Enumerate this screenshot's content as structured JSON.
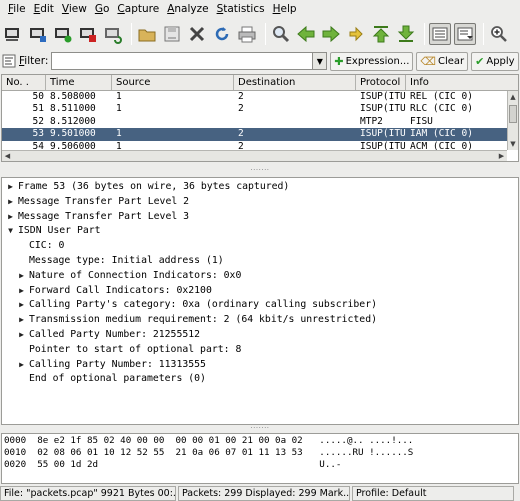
{
  "menu": [
    "File",
    "Edit",
    "View",
    "Go",
    "Capture",
    "Analyze",
    "Statistics",
    "Help"
  ],
  "menu_mnemonics": [
    "F",
    "E",
    "V",
    "G",
    "C",
    "A",
    "S",
    "H"
  ],
  "toolbar_icons": [
    "interface-list-icon",
    "capture-options-icon",
    "start-capture-icon",
    "stop-capture-icon",
    "restart-capture-icon",
    "open-file-icon",
    "save-file-icon",
    "close-file-icon",
    "reload-icon",
    "print-icon",
    "find-packet-icon",
    "go-back-icon",
    "go-forward-icon",
    "go-to-packet-icon",
    "go-first-packet-icon",
    "go-last-packet-icon",
    "colorize-icon",
    "autoscroll-icon",
    "zoom-in-icon"
  ],
  "filter": {
    "label": "Filter:",
    "value": "",
    "expression_label": "Expression...",
    "clear_label": "Clear",
    "apply_label": "Apply"
  },
  "packet_list": {
    "columns": [
      "No. .",
      "Time",
      "Source",
      "Destination",
      "Protocol",
      "Info"
    ],
    "rows": [
      {
        "no": "50",
        "time": "8.508000",
        "src": "1",
        "dst": "2",
        "proto": "ISUP(ITU",
        "info": "REL (CIC 0)",
        "selected": false
      },
      {
        "no": "51",
        "time": "8.511000",
        "src": "1",
        "dst": "2",
        "proto": "ISUP(ITU",
        "info": "RLC (CIC 0)",
        "selected": false
      },
      {
        "no": "52",
        "time": "8.512000",
        "src": "",
        "dst": "",
        "proto": "MTP2",
        "info": "FISU",
        "selected": false
      },
      {
        "no": "53",
        "time": "9.501000",
        "src": "1",
        "dst": "2",
        "proto": "ISUP(ITU",
        "info": "IAM (CIC 0)",
        "selected": true
      },
      {
        "no": "54",
        "time": "9.506000",
        "src": "1",
        "dst": "2",
        "proto": "ISUP(ITU",
        "info": "ACM (CIC 0)",
        "selected": false
      }
    ]
  },
  "details": [
    {
      "text": "Frame 53 (36 bytes on wire, 36 bytes captured)",
      "level": 1,
      "expander": "collapsed"
    },
    {
      "text": "Message Transfer Part Level 2",
      "level": 1,
      "expander": "collapsed"
    },
    {
      "text": "Message Transfer Part Level 3",
      "level": 1,
      "expander": "collapsed"
    },
    {
      "text": "ISDN User Part",
      "level": 1,
      "expander": "expanded"
    },
    {
      "text": "CIC: 0",
      "level": 2,
      "expander": "none"
    },
    {
      "text": "Message type: Initial address (1)",
      "level": 2,
      "expander": "none"
    },
    {
      "text": "Nature of Connection Indicators: 0x0",
      "level": 2,
      "expander": "collapsed"
    },
    {
      "text": "Forward Call Indicators: 0x2100",
      "level": 2,
      "expander": "collapsed"
    },
    {
      "text": "Calling Party's category: 0xa (ordinary calling subscriber)",
      "level": 2,
      "expander": "collapsed"
    },
    {
      "text": "Transmission medium requirement: 2 (64 kbit/s unrestricted)",
      "level": 2,
      "expander": "collapsed"
    },
    {
      "text": "Called Party Number: 21255512",
      "level": 2,
      "expander": "collapsed"
    },
    {
      "text": "Pointer to start of optional part: 8",
      "level": 2,
      "expander": "none"
    },
    {
      "text": "Calling Party Number: 11313555",
      "level": 2,
      "expander": "collapsed"
    },
    {
      "text": "End of optional parameters (0)",
      "level": 2,
      "expander": "none"
    }
  ],
  "bytes": [
    "0000  8e e2 1f 85 02 40 00 00  00 00 01 00 21 00 0a 02   .....@.. ....!...",
    "0010  02 08 06 01 10 12 52 55  21 0a 06 07 01 11 13 53   ......RU !......S",
    "0020  55 00 1d 2d                                        U..-"
  ],
  "status": {
    "file": "File: \"packets.pcap\" 9921 Bytes 00:...",
    "packets": "Packets: 299 Displayed: 299 Mark...",
    "profile": "Profile: Default"
  },
  "colors": {
    "selection": "#476281",
    "window_bg": "#ededeb"
  }
}
